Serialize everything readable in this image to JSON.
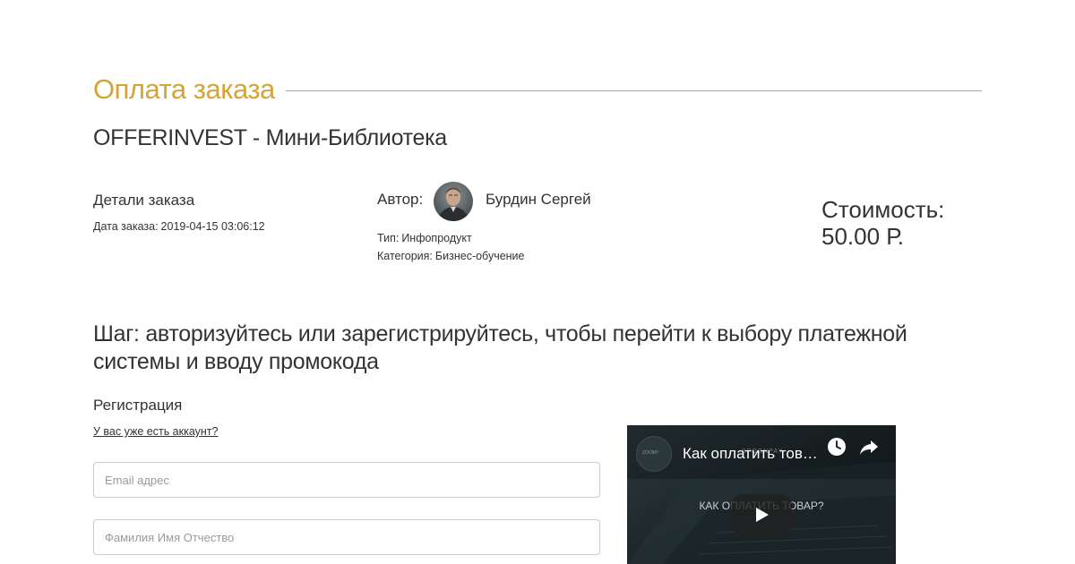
{
  "page": {
    "title": "Оплата заказа",
    "product_name": "OFFERINVEST - Мини-Библиотека",
    "accent_color": "#d4a437"
  },
  "order": {
    "details_heading": "Детали заказа",
    "date_label": "Дата заказа:",
    "date_value": "2019-04-15 03:06:12"
  },
  "author": {
    "label": "Автор:",
    "name": "Бурдин Сергей",
    "type_label": "Тип:",
    "type_value": "Инфопродукт",
    "category_label": "Категория:",
    "category_value": "Бизнес-обучение"
  },
  "price": {
    "label": "Стоимость:",
    "value": "50.00 Р."
  },
  "step": {
    "text": "Шаг: авторизуйтесь или зарегистрируйтесь, чтобы перейти к выбору платежной системы и вводу промокода"
  },
  "registration": {
    "heading": "Регистрация",
    "have_account_link": "У вас уже есть аккаунт?",
    "email_placeholder": "Email адрес",
    "name_placeholder": "Фамилия Имя Отчество"
  },
  "video": {
    "title": "Как оплатить товар?",
    "overlay_text": "КАК ОПЛАТИТЬ ТОВАР?",
    "brand": "SPOONPAY",
    "channel_text": "ZOOMY",
    "icons": [
      "watch-later-icon",
      "share-icon",
      "play-icon"
    ]
  }
}
